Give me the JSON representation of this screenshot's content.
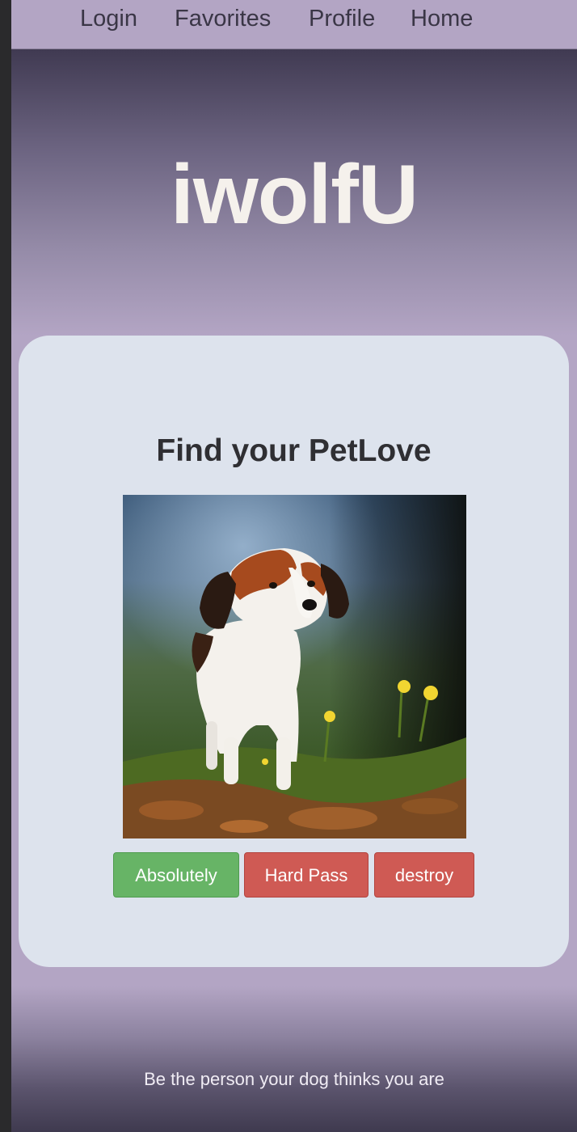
{
  "nav": {
    "items": [
      {
        "label": "Login"
      },
      {
        "label": "Favorites"
      },
      {
        "label": "Profile"
      },
      {
        "label": "Home"
      }
    ]
  },
  "hero": {
    "brand": "iwolfU"
  },
  "card": {
    "title": "Find your PetLove",
    "photo_icon": "dog-photo",
    "buttons": {
      "yes_label": "Absolutely",
      "pass_label": "Hard Pass",
      "destroy_label": "destroy"
    }
  },
  "footer": {
    "tagline": "Be the person your dog thinks you are"
  },
  "colors": {
    "nav_bg": "#b3a5c4",
    "card_bg": "#dde3ed",
    "yes_button": "#67b466",
    "pass_button": "#cf5a54",
    "brand_text": "#f5f1ec"
  }
}
